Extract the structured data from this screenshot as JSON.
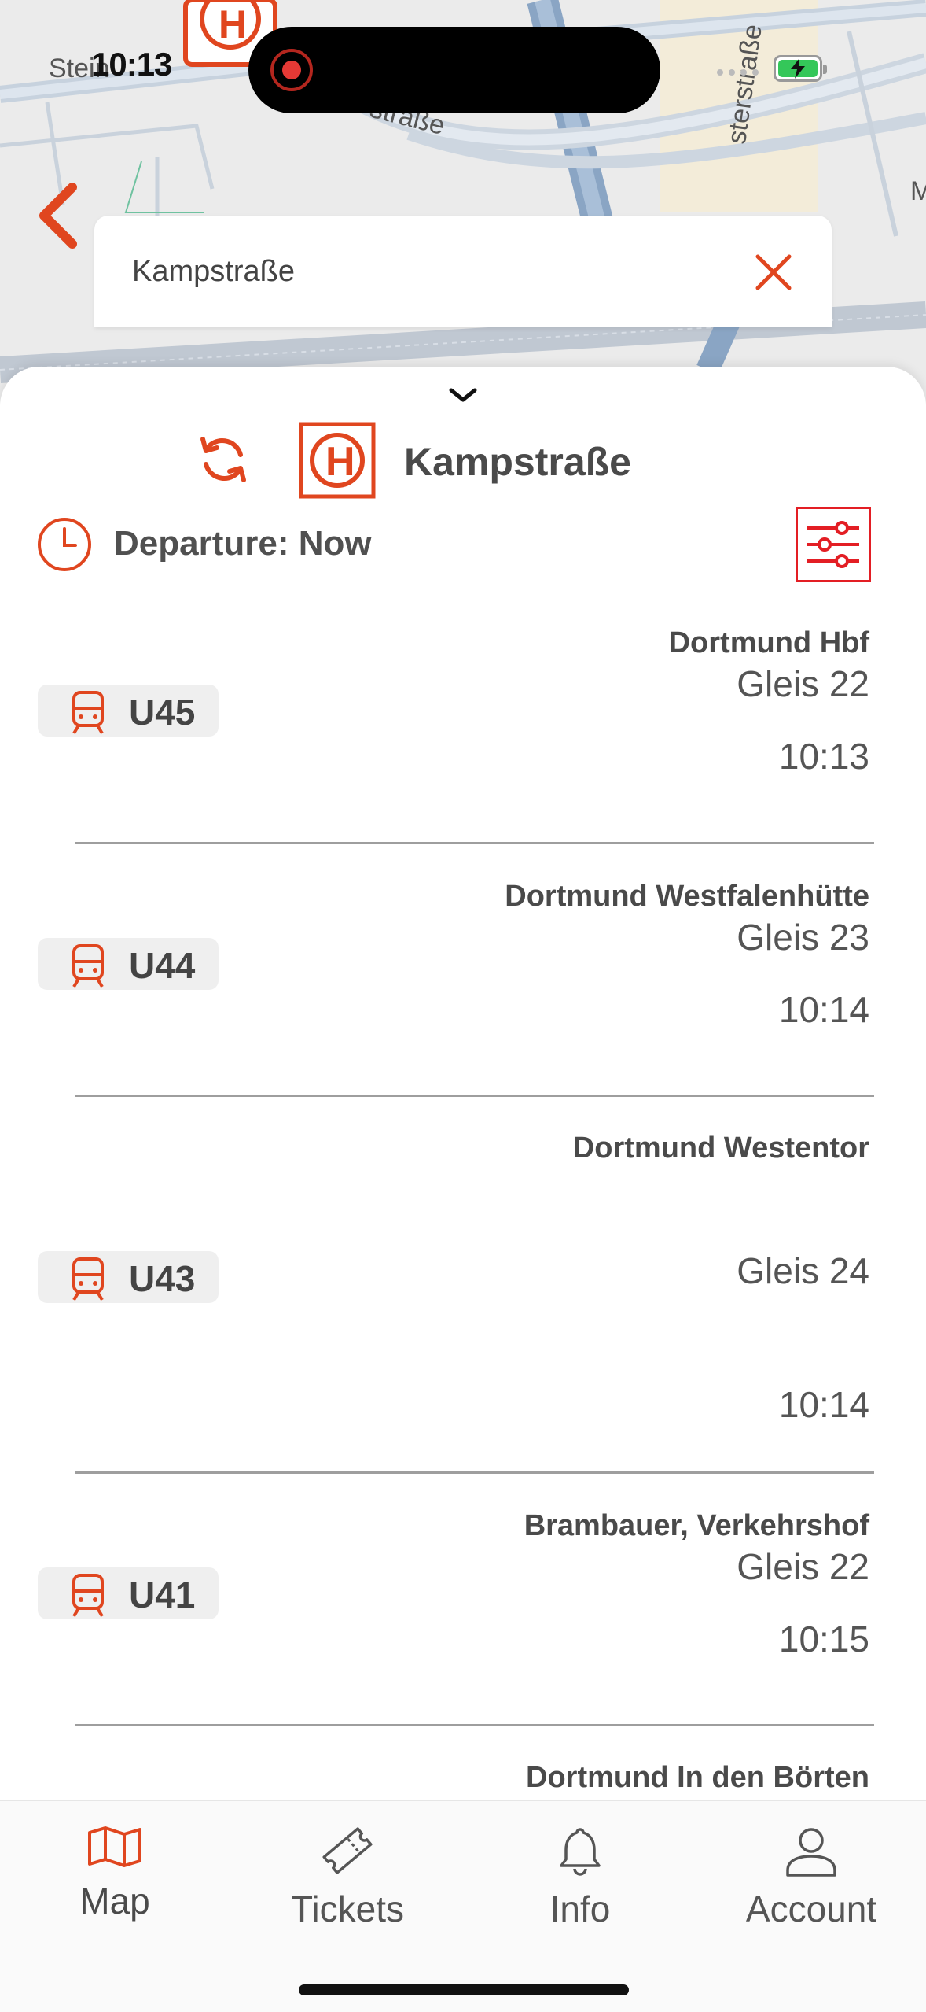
{
  "map": {
    "labels": [
      "Stein",
      "straße",
      "sterstraße",
      "M"
    ]
  },
  "status_bar": {
    "time": "10:13",
    "battery_icon": "battery-charging-icon"
  },
  "search": {
    "value": "Kampstraße",
    "clear_icon": "close-icon",
    "back_icon": "chevron-left-icon"
  },
  "stop": {
    "name": "Kampstraße",
    "logo_letter": "H",
    "refresh_icon": "refresh-icon"
  },
  "departure": {
    "label": "Departure: Now",
    "filter_icon": "filter-sliders-icon"
  },
  "departures": [
    {
      "line": "U45",
      "destination": "Dortmund Hbf",
      "platform": "Gleis 22",
      "time": "10:13"
    },
    {
      "line": "U44",
      "destination": "Dortmund Westfalenhütte",
      "platform": "Gleis 23",
      "time": "10:14"
    },
    {
      "line": "U43",
      "destination": "Dortmund Westentor",
      "platform": "Gleis 24",
      "time": "10:14"
    },
    {
      "line": "U41",
      "destination": "Brambauer, Verkehrshof",
      "platform": "Gleis 22",
      "time": "10:15"
    },
    {
      "line": "",
      "destination": "Dortmund In den Börten",
      "platform": "",
      "time": ""
    }
  ],
  "tabs": [
    {
      "label": "Map",
      "icon": "map-icon",
      "active": true
    },
    {
      "label": "Tickets",
      "icon": "ticket-icon",
      "active": false
    },
    {
      "label": "Info",
      "icon": "bell-icon",
      "active": false
    },
    {
      "label": "Account",
      "icon": "user-icon",
      "active": false
    }
  ],
  "colors": {
    "accent": "#e0461f",
    "brand_red": "#e31e24",
    "text": "#4a4a4a",
    "divider": "#9e9e9e"
  }
}
